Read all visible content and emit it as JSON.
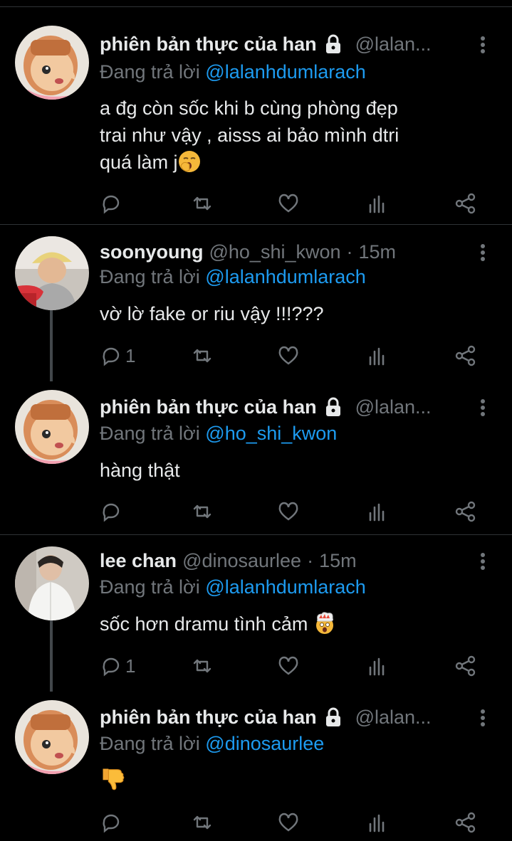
{
  "colors": {
    "background": "#000000",
    "text": "#e7e9ea",
    "muted": "#71767b",
    "link": "#1d9bf0",
    "divider": "#2f3336"
  },
  "tweets": [
    {
      "name": "phiên bản thực của han",
      "handle": "@lalan...",
      "protected": true,
      "time": "",
      "replying_prefix": "Đang trả lời",
      "replying_to": "@lalanhdumlarach",
      "lines": [
        "a đg còn sốc khi b cùng phòng  đẹp",
        "trai như vậy , aisss ai bảo mình dtri",
        "quá làm j"
      ],
      "emoji": "yawning-face-emoji",
      "reply_count": ""
    },
    {
      "name": "soonyoung",
      "handle": "@ho_shi_kwon",
      "protected": false,
      "time": "15m",
      "replying_prefix": "Đang trả lời",
      "replying_to": "@lalanhdumlarach",
      "lines": [
        "vờ lờ fake or riu vậy !!!???"
      ],
      "emoji": "",
      "reply_count": "1"
    },
    {
      "name": "phiên bản thực của han",
      "handle": "@lalan...",
      "protected": true,
      "time": "",
      "replying_prefix": "Đang trả lời",
      "replying_to": "@ho_shi_kwon",
      "lines": [
        "hàng thật"
      ],
      "emoji": "",
      "reply_count": ""
    },
    {
      "name": "lee chan",
      "handle": "@dinosaurlee",
      "protected": false,
      "time": "15m",
      "replying_prefix": "Đang trả lời",
      "replying_to": "@lalanhdumlarach",
      "lines": [
        "sốc hơn dramu tình cảm"
      ],
      "emoji": "exploding-head-emoji",
      "reply_count": "1"
    },
    {
      "name": "phiên bản thực của han",
      "handle": "@lalan...",
      "protected": true,
      "time": "",
      "replying_prefix": "Đang trả lời",
      "replying_to": "@dinosaurlee",
      "lines": [
        ""
      ],
      "emoji": "thumbs-down-emoji",
      "reply_count": ""
    }
  ],
  "icons": [
    "reply-icon",
    "retweet-icon",
    "like-icon",
    "analytics-icon",
    "share-icon",
    "more-options-icon",
    "lock-icon"
  ]
}
